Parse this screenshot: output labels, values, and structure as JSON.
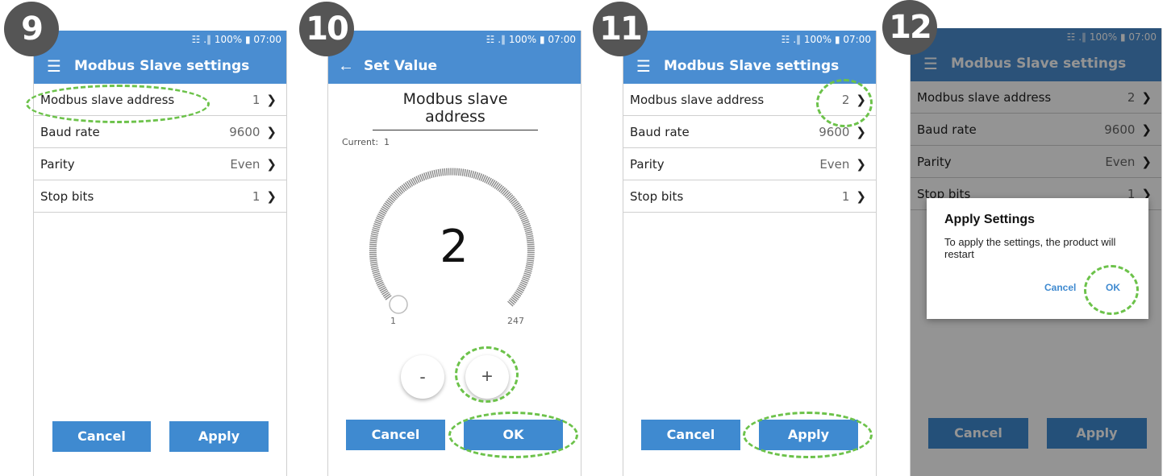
{
  "status_bar": "☷ .∥ 100% ▮ 07:00",
  "steps": [
    "9",
    "10",
    "11",
    "12"
  ],
  "screen9": {
    "menu_icon": "hamburger-icon",
    "title": "Modbus Slave settings",
    "rows": [
      {
        "label": "Modbus slave address",
        "value": "1"
      },
      {
        "label": "Baud rate",
        "value": "9600"
      },
      {
        "label": "Parity",
        "value": "Even"
      },
      {
        "label": "Stop bits",
        "value": "1"
      }
    ],
    "cancel": "Cancel",
    "apply": "Apply"
  },
  "screen10": {
    "back_icon": "back-arrow-icon",
    "title": "Set Value",
    "heading": "Modbus slave address",
    "current": "Current:  1",
    "dial_value": "2",
    "dial_min": "1",
    "dial_max": "247",
    "minus": "-",
    "plus": "+",
    "cancel": "Cancel",
    "ok": "OK"
  },
  "screen11": {
    "title": "Modbus Slave settings",
    "rows": [
      {
        "label": "Modbus slave address",
        "value": "2"
      },
      {
        "label": "Baud rate",
        "value": "9600"
      },
      {
        "label": "Parity",
        "value": "Even"
      },
      {
        "label": "Stop bits",
        "value": "1"
      }
    ],
    "cancel": "Cancel",
    "apply": "Apply"
  },
  "screen12": {
    "title": "Modbus Slave settings",
    "rows": [
      {
        "label": "Modbus slave address",
        "value": "2"
      },
      {
        "label": "Baud rate",
        "value": "9600"
      },
      {
        "label": "Parity",
        "value": "Even"
      },
      {
        "label": "Stop bits",
        "value": "1"
      }
    ],
    "dialog_title": "Apply Settings",
    "dialog_text": "To apply the settings, the product will restart",
    "dialog_cancel": "Cancel",
    "dialog_ok": "OK",
    "cancel": "Cancel",
    "apply": "Apply"
  },
  "colors": {
    "accent": "#4a8dd1",
    "button": "#3f8ad0",
    "highlight": "#6cc24a",
    "badge": "#555555"
  }
}
